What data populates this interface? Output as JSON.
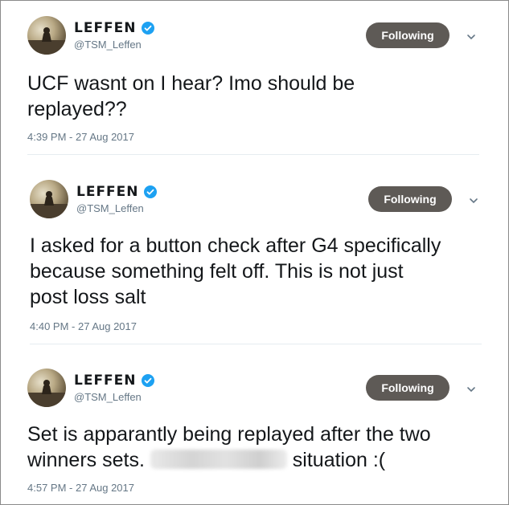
{
  "tweets": [
    {
      "name": "LEFFEN",
      "handle": "@TSM_Leffen",
      "follow_label": "Following",
      "text_lines": [
        "UCF wasnt on I hear? Imo should be",
        "replayed??"
      ],
      "timestamp": "4:39 PM - 27 Aug 2017"
    },
    {
      "name": "LEFFEN",
      "handle": "@TSM_Leffen",
      "follow_label": "Following",
      "text_lines": [
        "I asked for a button check after G4 specifically",
        "because something felt off. This is not just",
        "post loss salt"
      ],
      "timestamp": "4:40 PM - 27 Aug 2017"
    },
    {
      "name": "LEFFEN",
      "handle": "@TSM_Leffen",
      "follow_label": "Following",
      "text_lines": [
        "Set is apparantly being replayed after the two"
      ],
      "text_line2_before": "winners sets.",
      "text_line2_after": "situation :(",
      "timestamp": "4:57 PM - 27 Aug 2017"
    }
  ],
  "icons": {
    "verified": "verified-badge-icon",
    "caret": "chevron-down-icon"
  },
  "colors": {
    "button_bg": "#5e5a56",
    "verified": "#1da1f2",
    "muted": "#657786"
  }
}
